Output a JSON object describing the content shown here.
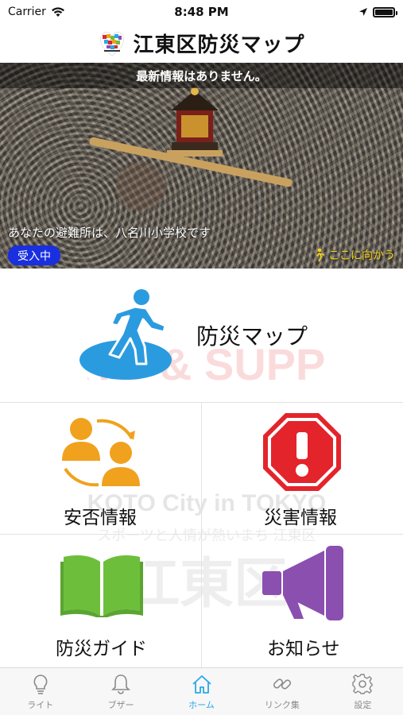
{
  "status_bar": {
    "carrier": "Carrier",
    "time": "8:48 PM"
  },
  "header": {
    "title": "江東区防災マップ"
  },
  "hero": {
    "news": "最新情報はありません。",
    "shelter": "あなたの避難所は、八名川小学校です",
    "badge": "受入中",
    "go_here": "ここに向かう"
  },
  "tiles": {
    "map": "防災マップ",
    "safety": "安否情報",
    "disaster": "災害情報",
    "guide": "防災ガイド",
    "notice": "お知らせ"
  },
  "watermark": {
    "top": "SPORTS & SUPPORTS",
    "city": "KOTO City in TOKYO",
    "slogan": "スポーツと人情が熱いまち 江東区",
    "ward": "江東区"
  },
  "tabs": [
    {
      "label": "ライト",
      "icon": "lightbulb-icon"
    },
    {
      "label": "ブザー",
      "icon": "bell-icon"
    },
    {
      "label": "ホーム",
      "icon": "home-icon"
    },
    {
      "label": "リンク集",
      "icon": "link-icon"
    },
    {
      "label": "設定",
      "icon": "gear-icon"
    }
  ],
  "colors": {
    "accent": "#2aa8e8",
    "badge": "#1a2fe0",
    "warning": "#f1d21a",
    "orange": "#f0a21e",
    "red": "#e3242b",
    "green": "#6dbf3b",
    "purple": "#8b4fb0"
  }
}
